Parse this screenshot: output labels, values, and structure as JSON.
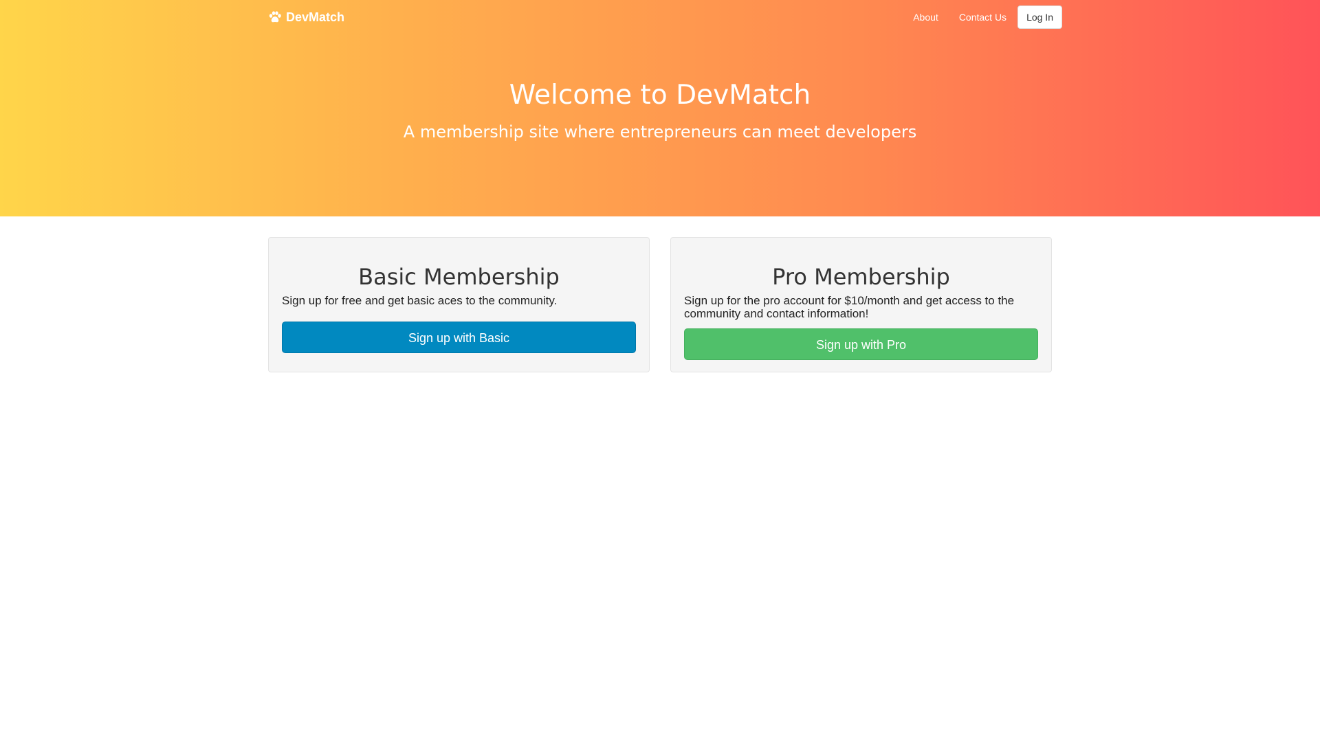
{
  "colors": {
    "hero_gradient_start": "#ffd54a",
    "hero_gradient_end": "#ff5358",
    "basic_button": "#0189c0",
    "pro_button": "#50c06a",
    "card_background": "#f5f5f5"
  },
  "navbar": {
    "brand_icon": "paw-icon",
    "brand_label": "DevMatch",
    "links": [
      {
        "label": "About"
      },
      {
        "label": "Contact Us"
      }
    ],
    "login_label": "Log In"
  },
  "hero": {
    "title": "Welcome to DevMatch",
    "subtitle": "A membership site where entrepreneurs can meet developers"
  },
  "plans": {
    "basic": {
      "title": "Basic Membership",
      "description": "Sign up for free and get basic aces to the community.",
      "button_label": "Sign up with Basic"
    },
    "pro": {
      "title": "Pro Membership",
      "description": "Sign up for the pro account for $10/month and get access to the community and contact information!",
      "button_label": "Sign up with Pro"
    }
  }
}
